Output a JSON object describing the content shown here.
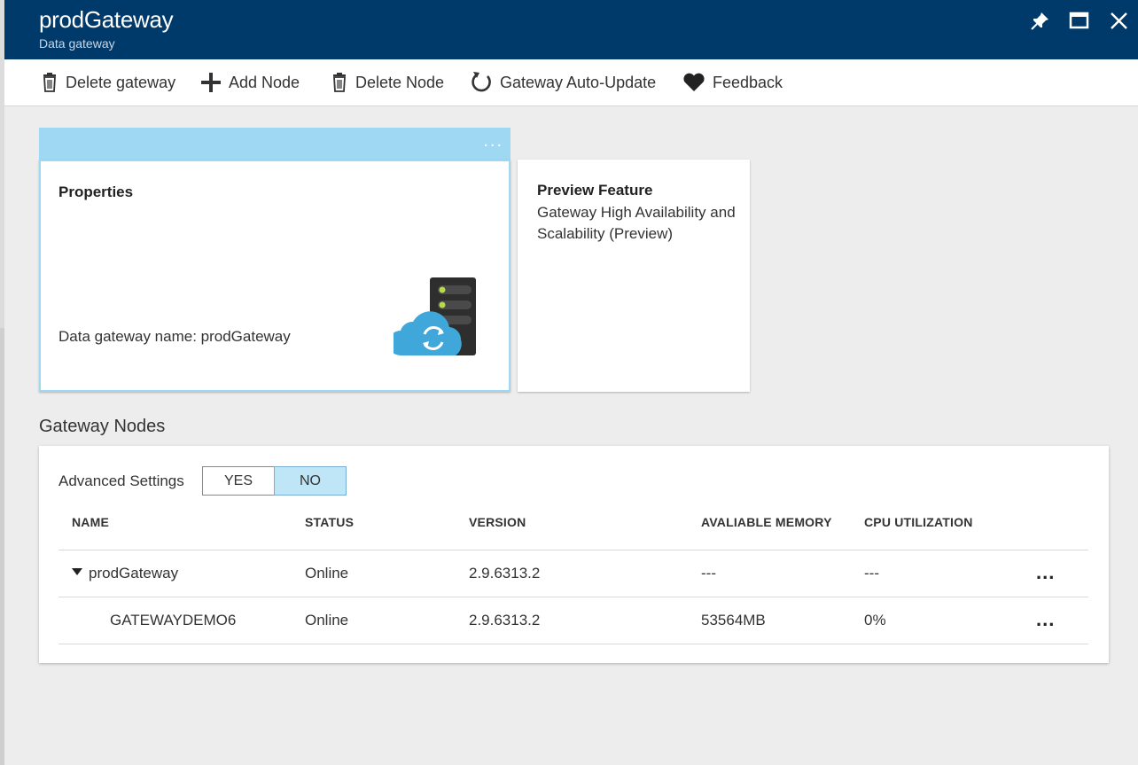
{
  "header": {
    "title": "prodGateway",
    "subtitle": "Data gateway"
  },
  "header_buttons": [
    {
      "icon": "pin-icon"
    },
    {
      "icon": "maximize-icon"
    },
    {
      "icon": "close-icon"
    }
  ],
  "toolbar": {
    "delete_gateway": "Delete gateway",
    "add_node": "Add Node",
    "delete_node": "Delete Node",
    "auto_update": "Gateway Auto-Update",
    "feedback": "Feedback"
  },
  "tiles": {
    "strip_dots": "...",
    "properties": {
      "title": "Properties",
      "name_line": "Data gateway name: prodGateway"
    },
    "preview": {
      "title": "Preview Feature",
      "body": "Gateway High Availability and Scalability (Preview)"
    }
  },
  "nodes": {
    "section_title": "Gateway Nodes",
    "advanced_label": "Advanced Settings",
    "toggle_yes": "YES",
    "toggle_no": "NO",
    "toggle_selected": "NO",
    "columns": {
      "name": "NAME",
      "status": "STATUS",
      "version": "VERSION",
      "memory": "AVALIABLE MEMORY",
      "cpu": "CPU UTILIZATION"
    },
    "rows": [
      {
        "name": "prodGateway",
        "status": "Online",
        "version": "2.9.6313.2",
        "memory": "---",
        "cpu": "---",
        "more": "..."
      },
      {
        "name": "GATEWAYDEMO6",
        "status": "Online",
        "version": "2.9.6313.2",
        "memory": "53564MB",
        "cpu": "0%",
        "more": "..."
      }
    ]
  },
  "colors": {
    "header_bg": "#003a6a",
    "tile_accent": "#9ed8f3",
    "toggle_selected_bg": "#bfe6f6",
    "cloud": "#3fa7d9",
    "server": "#2e2e2e",
    "led": "#b8d94a"
  }
}
